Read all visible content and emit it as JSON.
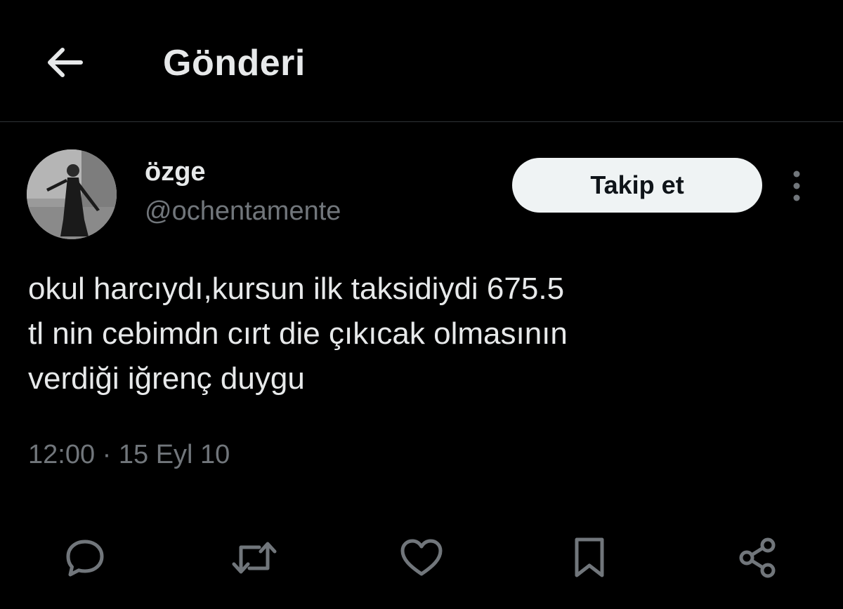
{
  "header": {
    "title": "Gönderi",
    "back_icon": "arrow-left-icon"
  },
  "author": {
    "display_name": "özge",
    "handle": "@ochentamente",
    "follow_label": "Takip et"
  },
  "tweet": {
    "text": "okul harcıydı,kursun ilk taksidiydi 675.5\ntl nin cebimdn cırt die çıkıcak olmasının\nverdiği iğrenç duygu",
    "timestamp": "12:00 · 15 Eyl 10"
  },
  "actions": [
    "reply-icon",
    "retweet-icon",
    "like-icon",
    "bookmark-icon",
    "share-icon"
  ],
  "colors": {
    "background": "#000000",
    "text_primary": "#e7e9ea",
    "text_secondary": "#71767b",
    "divider": "#2f3336",
    "follow_bg": "#eff3f4"
  }
}
